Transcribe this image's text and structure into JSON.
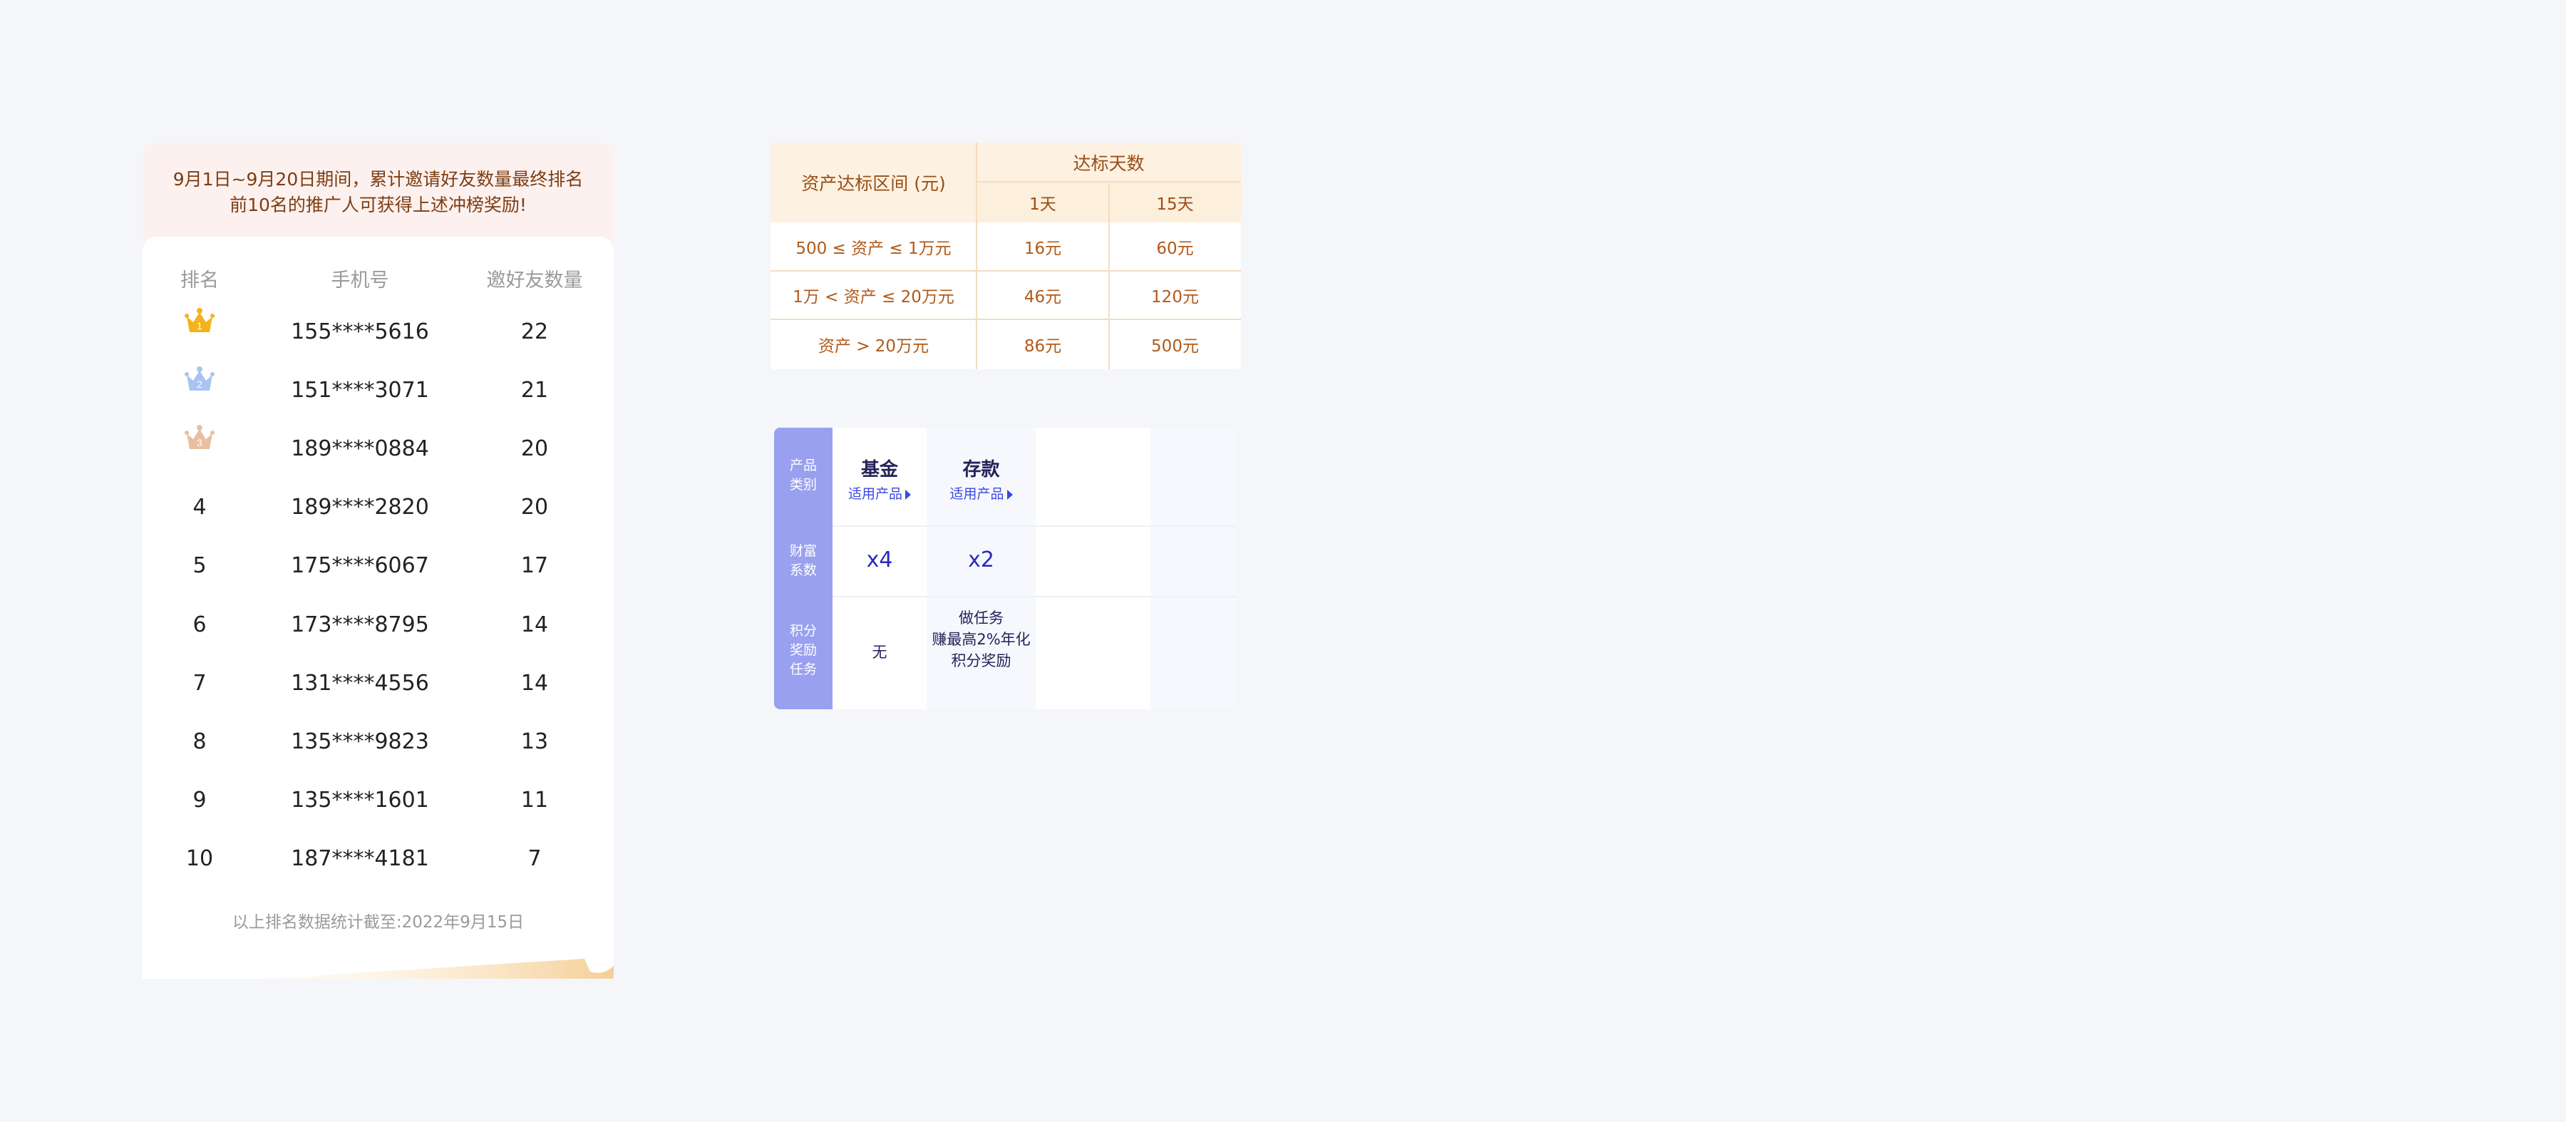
{
  "ranking": {
    "banner": "9月1日~9月20日期间，累计邀请好友数量最终排名前10名的推广人可获得上述冲榜奖励!",
    "banner_line1": "9月1日~9月20日期间，累计邀请好友数量最终排名",
    "banner_line2": "前10名的推广人可获得上述冲榜奖励!",
    "headers": {
      "rank": "排名",
      "phone": "手机号",
      "count": "邀好友数量"
    },
    "rows": [
      {
        "rank": "1",
        "phone": "155****5616",
        "count": "22",
        "crown": "gold"
      },
      {
        "rank": "2",
        "phone": "151****3071",
        "count": "21",
        "crown": "silver"
      },
      {
        "rank": "3",
        "phone": "189****0884",
        "count": "20",
        "crown": "bronze"
      },
      {
        "rank": "4",
        "phone": "189****2820",
        "count": "20"
      },
      {
        "rank": "5",
        "phone": "175****6067",
        "count": "17"
      },
      {
        "rank": "6",
        "phone": "173****8795",
        "count": "14"
      },
      {
        "rank": "7",
        "phone": "131****4556",
        "count": "14"
      },
      {
        "rank": "8",
        "phone": "135****9823",
        "count": "13"
      },
      {
        "rank": "9",
        "phone": "135****1601",
        "count": "11"
      },
      {
        "rank": "10",
        "phone": "187****4181",
        "count": "7"
      }
    ],
    "footer": "以上排名数据统计截至:2022年9月15日",
    "colors": {
      "gold": "#f5b21c",
      "silver": "#a9c4f2",
      "bronze": "#e9bfa0"
    }
  },
  "asset_table": {
    "col_header": "资产达标区间 (元)",
    "group_header": "达标天数",
    "sub_headers": [
      "1天",
      "15天"
    ],
    "rows": [
      {
        "range": "500 ≤ 资产 ≤ 1万元",
        "d1": "16元",
        "d15": "60元"
      },
      {
        "range": "1万 < 资产 ≤ 20万元",
        "d1": "46元",
        "d15": "120元"
      },
      {
        "range": "资产 > 20万元",
        "d1": "86元",
        "d15": "500元"
      }
    ]
  },
  "product_table": {
    "side_labels": [
      "产品\n类别",
      "财富\n系数",
      "积分\n奖励\n任务"
    ],
    "side_label_lines": [
      [
        "产品",
        "类别"
      ],
      [
        "财富",
        "系数"
      ],
      [
        "积分",
        "奖励",
        "任务"
      ]
    ],
    "products": [
      {
        "name": "基金",
        "link": "适用产品",
        "multiplier": "x4",
        "task": [
          "无"
        ]
      },
      {
        "name": "存款",
        "link": "适用产品",
        "multiplier": "x2",
        "task": [
          "做任务",
          "赚最高2%年化",
          "积分奖励"
        ]
      }
    ],
    "accent": "#9aa0f0"
  }
}
